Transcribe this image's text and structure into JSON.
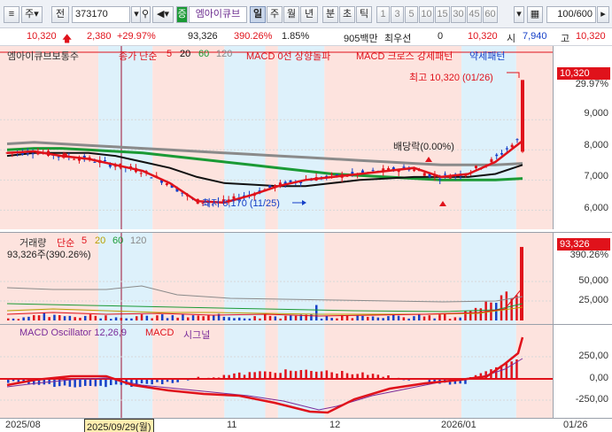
{
  "toolbar": {
    "market": "주",
    "jeon": "전",
    "code": "373170",
    "stock_name": "엠아이큐브",
    "periods": [
      "일",
      "주",
      "월",
      "년",
      "분",
      "초",
      "틱"
    ],
    "active_period": "일",
    "intervals": [
      "1",
      "3",
      "5",
      "10",
      "15",
      "30",
      "45",
      "60"
    ],
    "count": "100/600",
    "badge": "증"
  },
  "info": {
    "price": "10,320",
    "change": "2,380",
    "change_pct": "+29.97%",
    "volume": "93,326",
    "volume_pct": "390.26%",
    "turnover": "1.85%",
    "cap": "905백만",
    "status": "최우선",
    "zero": "0",
    "bid": "10,320",
    "open_label": "시",
    "open": "7,940",
    "high_label": "고",
    "high": "10,320"
  },
  "price_panel": {
    "legend_name": "엠아이큐브보통주",
    "legend_ma": "종가 단순",
    "ma_periods": [
      "5",
      "20",
      "60",
      "120"
    ],
    "legend_macd0": "MACD 0선 상향돌파",
    "legend_macd_cross": "MACD 크로스 강세패턴",
    "legend_weak": "약세패턴",
    "high_note": "최고 10,320 (01/26)",
    "low_note": "최저 6,170 (11/25)",
    "dividend_note": "배당락(0.00%)",
    "current": "10,320",
    "current_pct": "29.97%",
    "ticks": [
      "9,000",
      "8,000",
      "7,000",
      "6,000"
    ]
  },
  "volume_panel": {
    "title": "거래량",
    "ma": "단순",
    "ma_periods": [
      "5",
      "20",
      "60",
      "120"
    ],
    "value_line": "93,326주(390.26%)",
    "current": "93,326",
    "current_pct": "390.26%",
    "ticks": [
      "50,000",
      "25,000"
    ]
  },
  "macd_panel": {
    "title": "MACD Oscillator 12,26,9",
    "macd": "MACD",
    "signal": "시그널",
    "ticks": [
      "250,00",
      "0,00",
      "-250,00"
    ]
  },
  "xaxis": {
    "labels": [
      "2025/08",
      "11",
      "12",
      "2026/01"
    ],
    "cursor_date": "2025/09/29(월)",
    "right_date": "01/26"
  },
  "colors": {
    "up": "#e0121b",
    "down": "#1540c8",
    "ma5": "#e0121b",
    "ma20": "#111111",
    "ma60": "#1a9a35",
    "ma120": "#8a8a8a",
    "signal": "#7a2c9a",
    "bg_pink": "#fde3de",
    "bg_blue": "#ddf1fb"
  },
  "chart_data": {
    "type": "line",
    "title": "엠아이큐브보통주",
    "series": [
      {
        "name": "종가 단순 5",
        "values": [
          7900,
          7950,
          7800,
          7700,
          7500,
          7300,
          6900,
          6300,
          6250,
          6500,
          6800,
          7000,
          7100,
          7200,
          7300,
          7400,
          7100,
          7200,
          7600,
          8300
        ]
      },
      {
        "name": "종가 단순 20",
        "values": [
          7800,
          7900,
          7900,
          7900,
          7800,
          7600,
          7400,
          7100,
          6900,
          6850,
          6800,
          6800,
          6900,
          7000,
          7050,
          7100,
          7100,
          7100,
          7200,
          7500
        ]
      },
      {
        "name": "종가 단순 60",
        "values": [
          8000,
          8050,
          8050,
          8000,
          7950,
          7900,
          7800,
          7700,
          7600,
          7500,
          7400,
          7300,
          7200,
          7150,
          7100,
          7050,
          7000,
          7000,
          7000,
          7050
        ]
      },
      {
        "name": "종가 단순 120",
        "values": [
          8200,
          8250,
          8200,
          8150,
          8100,
          8050,
          8000,
          7950,
          7900,
          7850,
          7800,
          7750,
          7700,
          7650,
          7600,
          7550,
          7500,
          7500,
          7500,
          7550
        ]
      }
    ],
    "ylim": [
      5600,
      10800
    ],
    "high": 10320,
    "low": 6170,
    "volume_current": 93326,
    "volume_ylim": [
      0,
      100000
    ]
  }
}
